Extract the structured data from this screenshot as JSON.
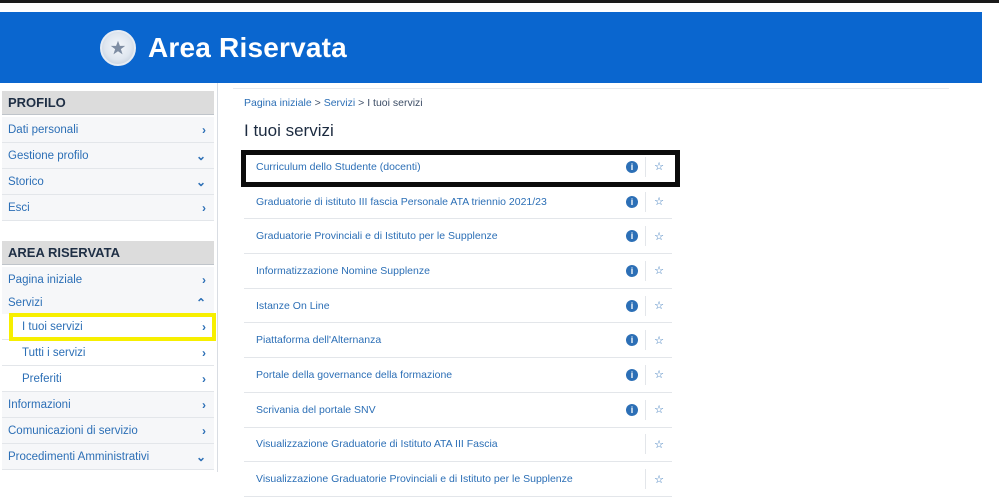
{
  "header": {
    "title": "Area Riservata"
  },
  "sidebar": {
    "profilo": {
      "heading": "PROFILO",
      "items": [
        {
          "label": "Dati personali",
          "chevron": "›"
        },
        {
          "label": "Gestione profilo",
          "chevron": "⌄"
        },
        {
          "label": "Storico",
          "chevron": "⌄"
        },
        {
          "label": "Esci",
          "chevron": "›"
        }
      ]
    },
    "area": {
      "heading": "AREA RISERVATA",
      "items": [
        {
          "label": "Pagina iniziale",
          "chevron": "›"
        },
        {
          "label": "Servizi",
          "chevron": "⌃"
        },
        {
          "label": "I tuoi servizi",
          "chevron": "›"
        },
        {
          "label": "Tutti i servizi",
          "chevron": "›"
        },
        {
          "label": "Preferiti",
          "chevron": "›"
        },
        {
          "label": "Informazioni",
          "chevron": "›"
        },
        {
          "label": "Comunicazioni di servizio",
          "chevron": "›"
        },
        {
          "label": "Procedimenti Amministrativi",
          "chevron": "⌄"
        }
      ]
    }
  },
  "breadcrumb": {
    "home": "Pagina iniziale",
    "sep": ">",
    "services": "Servizi",
    "current": "I tuoi servizi"
  },
  "main": {
    "title": "I tuoi servizi",
    "services": [
      {
        "label": "Curriculum dello Studente (docenti)"
      },
      {
        "label": "Graduatorie di istituto III fascia Personale ATA triennio 2021/23"
      },
      {
        "label": "Graduatorie Provinciali e di Istituto per le Supplenze"
      },
      {
        "label": "Informatizzazione Nomine Supplenze"
      },
      {
        "label": "Istanze On Line"
      },
      {
        "label": "Piattaforma dell'Alternanza"
      },
      {
        "label": "Portale della governance della formazione"
      },
      {
        "label": "Scrivania del portale SNV"
      },
      {
        "label": "Visualizzazione Graduatorie di Istituto ATA III Fascia"
      },
      {
        "label": "Visualizzazione Graduatorie Provinciali e di Istituto per le Supplenze"
      }
    ],
    "info_glyph": "i",
    "star_glyph": "☆"
  },
  "colors": {
    "header": "#0a66cf",
    "link": "#2c6fb6",
    "highlight_yellow": "#f7ef00",
    "highlight_black": "#0b0b0b"
  }
}
